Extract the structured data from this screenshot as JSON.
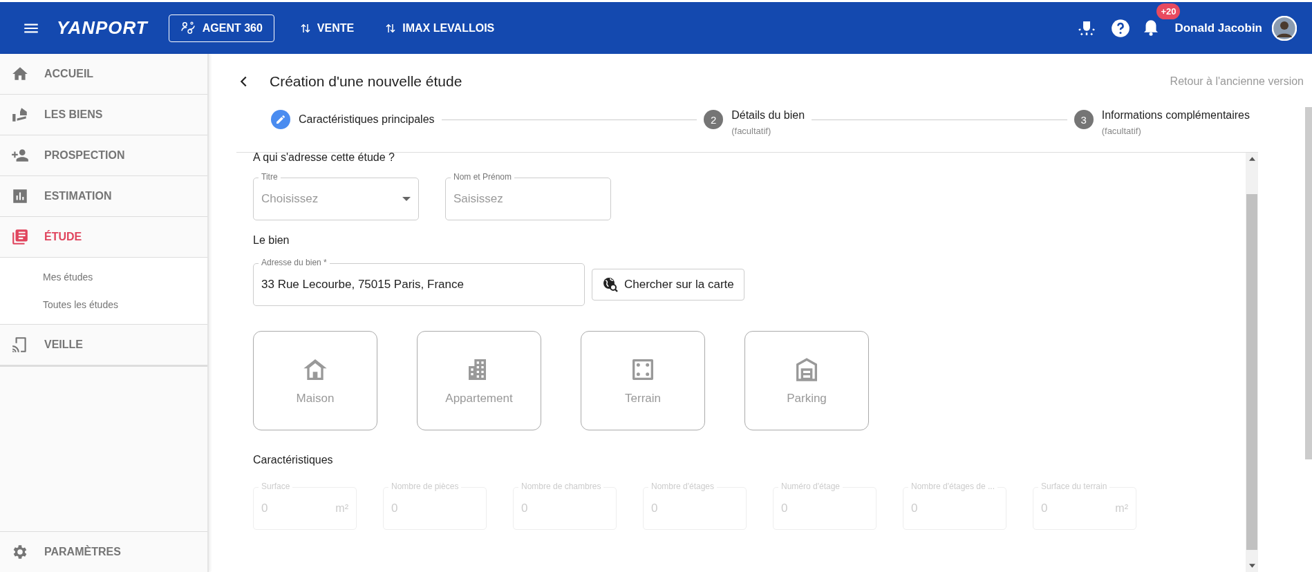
{
  "header": {
    "logo": "YANPORT",
    "nav": [
      {
        "label": "AGENT 360",
        "kind": "outlined"
      },
      {
        "label": "VENTE",
        "kind": "switch"
      },
      {
        "label": "IMAX LEVALLOIS",
        "kind": "switch"
      }
    ],
    "notifications": "+20",
    "user": "Donald Jacobin"
  },
  "sidebar": {
    "items": [
      {
        "label": "ACCUEIL",
        "selected": false
      },
      {
        "label": "LES BIENS",
        "selected": false
      },
      {
        "label": "PROSPECTION",
        "selected": false
      },
      {
        "label": "ESTIMATION",
        "selected": false
      },
      {
        "label": "ÉTUDE",
        "selected": true,
        "children": [
          {
            "label": "Mes études"
          },
          {
            "label": "Toutes les études"
          }
        ]
      },
      {
        "label": "VEILLE",
        "selected": false
      }
    ],
    "bottom": {
      "label": "PARAMÈTRES",
      "selected": false
    }
  },
  "page": {
    "title": "Création d'une nouvelle étude",
    "old_version_link": "Retour à l'ancienne version"
  },
  "stepper": [
    {
      "label": "Caractéristiques principales",
      "active": true
    },
    {
      "number": "2",
      "label": "Détails du bien",
      "hint": "(facultatif)",
      "active": false
    },
    {
      "number": "3",
      "label": "Informations complémentaires",
      "hint": "(facultatif)",
      "active": false
    }
  ],
  "form": {
    "recipient_section": "A qui s'adresse cette étude ?",
    "recipient_fields": [
      {
        "label": "Titre",
        "placeholder": "Choisissez",
        "kind": "select"
      },
      {
        "label": "Nom et Prénom",
        "placeholder": "Saisissez",
        "kind": "text"
      }
    ],
    "property_section": "Le bien",
    "address": {
      "label": "Adresse du bien *",
      "value": "33 Rue Lecourbe, 75015 Paris, France"
    },
    "map_button": "Chercher sur la carte",
    "property_types": [
      {
        "label": "Maison",
        "selected": false
      },
      {
        "label": "Appartement",
        "selected": false
      },
      {
        "label": "Terrain",
        "selected": false
      },
      {
        "label": "Parking",
        "selected": false
      }
    ],
    "features_section": "Caractéristiques",
    "features": [
      {
        "label": "Surface",
        "value": "0",
        "unit": "m²",
        "disabled": true
      },
      {
        "label": "Nombre de pièces",
        "value": "0",
        "disabled": true
      },
      {
        "label": "Nombre de chambres",
        "value": "0",
        "disabled": true
      },
      {
        "label": "Nombre d'étages",
        "value": "0",
        "disabled": true
      },
      {
        "label": "Numéro d'étage",
        "value": "0",
        "disabled": true
      },
      {
        "label": "Nombre d'étages de ...",
        "value": "0",
        "disabled": true
      },
      {
        "label": "Surface du terrain",
        "value": "0",
        "unit": "m²",
        "disabled": true
      }
    ]
  }
}
